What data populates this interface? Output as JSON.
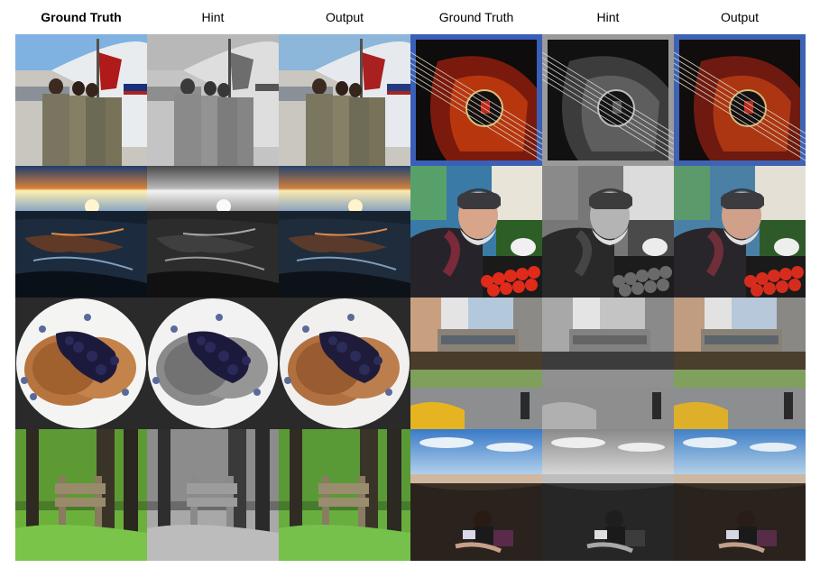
{
  "headers": [
    {
      "label": "Ground Truth"
    },
    {
      "label": "Hint"
    },
    {
      "label": "Output"
    },
    {
      "label": "Ground Truth"
    },
    {
      "label": "Hint"
    },
    {
      "label": "Output"
    }
  ],
  "rows": [
    {
      "left_scene": "soldiers-airplane",
      "right_scene": "acoustic-guitar"
    },
    {
      "left_scene": "sunset-shore",
      "right_scene": "old-man-market"
    },
    {
      "left_scene": "blueberry-pancakes",
      "right_scene": "elevated-train-street"
    },
    {
      "left_scene": "forest-signpost",
      "right_scene": "woman-reading-shade"
    }
  ],
  "colors": {
    "background": "#ffffff",
    "text": "#000000"
  }
}
